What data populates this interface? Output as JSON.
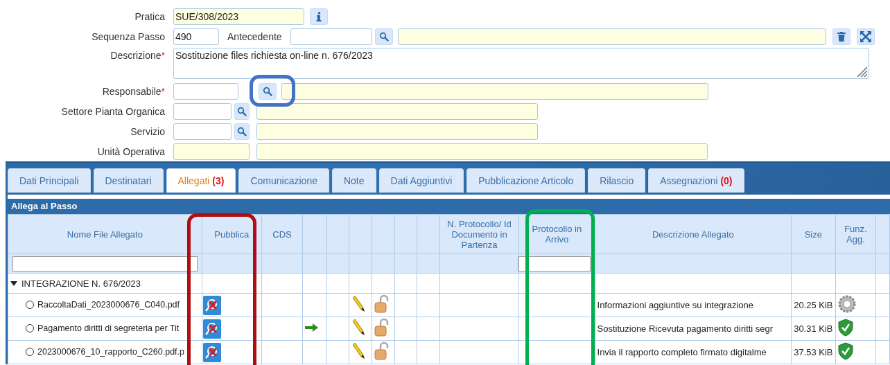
{
  "form": {
    "pratica": {
      "label": "Pratica",
      "value": "SUE/308/2023"
    },
    "sequenza": {
      "label": "Sequenza Passo",
      "value": "490"
    },
    "antecedente": {
      "label": "Antecedente"
    },
    "descrizione": {
      "label": "Descrizione",
      "mark": "*",
      "value": "Sostituzione files richiesta on-line n. 676/2023"
    },
    "responsabile": {
      "label": "Responsabile",
      "mark": "*"
    },
    "settore": {
      "label": "Settore Pianta Organica"
    },
    "servizio": {
      "label": "Servizio"
    },
    "unita": {
      "label": "Unità Operativa"
    }
  },
  "tabs": [
    {
      "label": "Dati Principali",
      "selected": false
    },
    {
      "label": "Destinatari",
      "selected": false
    },
    {
      "label": "Allegati",
      "count": "(3)",
      "selected": true
    },
    {
      "label": "Comunicazione",
      "selected": false
    },
    {
      "label": "Note",
      "selected": false
    },
    {
      "label": "Dati Aggiuntivi",
      "selected": false
    },
    {
      "label": "Pubblicazione Articolo",
      "selected": false
    },
    {
      "label": "Rilascio",
      "selected": false
    },
    {
      "label": "Assegnazioni",
      "count": "(0)",
      "selected": false
    }
  ],
  "panel": {
    "title": "Allega al Passo"
  },
  "table": {
    "columns": [
      {
        "label": "Nome File Allegato",
        "filter": true
      },
      {
        "label": "Pubblica",
        "filter": false
      },
      {
        "label": "CDS",
        "filter": false
      },
      {
        "filter": false
      },
      {
        "filter": false
      },
      {
        "filter": false
      },
      {
        "filter": false
      },
      {
        "filter": false
      },
      {
        "filter": false
      },
      {
        "label": "N. Protocollo/ Id Documento in Partenza",
        "filter": false
      },
      {
        "label": "Protocollo in Arrivo",
        "filter": true
      },
      {
        "label": "Descrizione Allegato",
        "filter": false
      },
      {
        "label": "Size",
        "filter": false
      },
      {
        "label": "Funz. Agg.",
        "filter": false
      }
    ],
    "group": {
      "label": "INTEGRAZIONE N. 676/2023",
      "expanded": true
    },
    "rows": [
      {
        "name": "RaccoltaDati_2023000676_C040.pdf",
        "selected": false,
        "forward_arrow": false,
        "description": "Informazioni aggiuntive su integrazione",
        "size": "20.25 KiB",
        "status": {
          "kind": "gear"
        }
      },
      {
        "name": "Pagamento diritti di segreteria per Tit",
        "selected": false,
        "forward_arrow": true,
        "description": "Sostituzione Ricevuta pagamento diritti segr",
        "size": "30.31 KiB",
        "status": {
          "kind": "shield"
        }
      },
      {
        "name": "2023000676_10_rapporto_C260.pdf.p",
        "selected": false,
        "forward_arrow": false,
        "description": "Invia il rapporto completo firmato digitalme",
        "size": "37.53 KiB",
        "status": {
          "kind": "shield"
        }
      }
    ]
  },
  "highlights": [
    {
      "color": "#b00d12"
    },
    {
      "color": "#4472c4"
    },
    {
      "color": "#00b050"
    }
  ]
}
